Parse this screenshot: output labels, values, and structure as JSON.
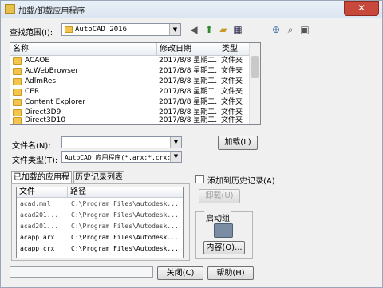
{
  "window": {
    "title": "加载/卸载应用程序",
    "close": "✕"
  },
  "toolbar": {
    "lookin_label": "查找范围(I):",
    "lookin_value": "AutoCAD 2016",
    "icons": [
      "back-icon",
      "up-folder-icon",
      "new-folder-icon",
      "views-icon",
      "search-web-icon",
      "find-icon",
      "places-icon"
    ]
  },
  "filelist": {
    "columns": [
      "名称",
      "修改日期",
      "类型"
    ],
    "rows": [
      {
        "name": "ACAOE",
        "date": "2017/8/8 星期二...",
        "type": "文件夹"
      },
      {
        "name": "AcWebBrowser",
        "date": "2017/8/8 星期二...",
        "type": "文件夹"
      },
      {
        "name": "AdlmRes",
        "date": "2017/8/8 星期二...",
        "type": "文件夹"
      },
      {
        "name": "CER",
        "date": "2017/8/8 星期二...",
        "type": "文件夹"
      },
      {
        "name": "Content Explorer",
        "date": "2017/8/8 星期二...",
        "type": "文件夹"
      },
      {
        "name": "Direct3D9",
        "date": "2017/8/8 星期二...",
        "type": "文件夹"
      },
      {
        "name": "Direct3D10",
        "date": "2017/8/8 星期二...",
        "type": "文件夹"
      }
    ]
  },
  "filename": {
    "label": "文件名(N):",
    "value": ""
  },
  "filetype": {
    "label": "文件类型(T):",
    "value": "AutoCAD 应用程序(*.arx;*.crx;*.lsp;*"
  },
  "load_button": "加载(L)",
  "tabs": [
    "已加载的应用程序",
    "历史记录列表"
  ],
  "add_history": {
    "label": "添加到历史记录(A)",
    "checked": false
  },
  "loaded_apps": {
    "columns": [
      "文件",
      "路径"
    ],
    "rows": [
      {
        "file": "acad.mnl",
        "path": "C:\\Program Files\\autodesk..."
      },
      {
        "file": "acad201...",
        "path": "C:\\Program Files\\Autodesk..."
      },
      {
        "file": "acad201...",
        "path": "C:\\Program Files\\Autodesk..."
      },
      {
        "file": "acapp.arx",
        "path": "C:\\Program Files\\Autodesk..."
      },
      {
        "file": "acapp.crx",
        "path": "C:\\Program Files\\Autodesk..."
      }
    ]
  },
  "unload_button": "卸载(U)",
  "startup": {
    "title": "启动组",
    "button": "内容(O)..."
  },
  "footer": {
    "close_button": "关闭(C)",
    "help_button": "帮助(H)"
  }
}
